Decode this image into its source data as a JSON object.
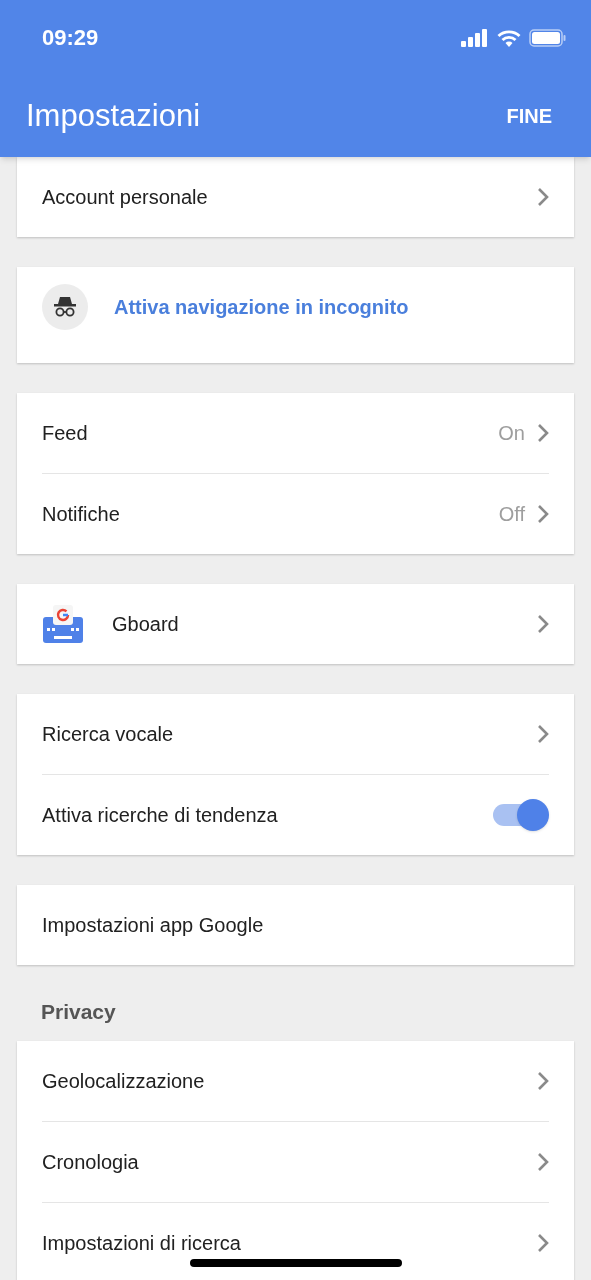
{
  "status_bar": {
    "time": "09:29"
  },
  "app_bar": {
    "title": "Impostazioni",
    "action": "FINE"
  },
  "sections": [
    {
      "cards": [
        {
          "rows": [
            {
              "kind": "nav",
              "label": "Account personale"
            }
          ]
        },
        {
          "rows": [
            {
              "kind": "incognito",
              "label": "Attiva navigazione in incognito"
            }
          ]
        },
        {
          "rows": [
            {
              "kind": "nav",
              "label": "Feed",
              "value": "On"
            },
            {
              "kind": "nav",
              "label": "Notifiche",
              "value": "Off"
            }
          ]
        },
        {
          "rows": [
            {
              "kind": "app",
              "label": "Gboard"
            }
          ]
        },
        {
          "rows": [
            {
              "kind": "nav",
              "label": "Ricerca vocale"
            },
            {
              "kind": "toggle",
              "label": "Attiva ricerche di tendenza",
              "on": true
            }
          ]
        },
        {
          "rows": [
            {
              "kind": "plain",
              "label": "Impostazioni app Google"
            }
          ]
        }
      ]
    },
    {
      "heading": "Privacy",
      "cards": [
        {
          "rows": [
            {
              "kind": "nav",
              "label": "Geolocalizzazione"
            },
            {
              "kind": "nav",
              "label": "Cronologia"
            },
            {
              "kind": "nav",
              "label": "Impostazioni di ricerca"
            }
          ]
        }
      ]
    }
  ]
}
